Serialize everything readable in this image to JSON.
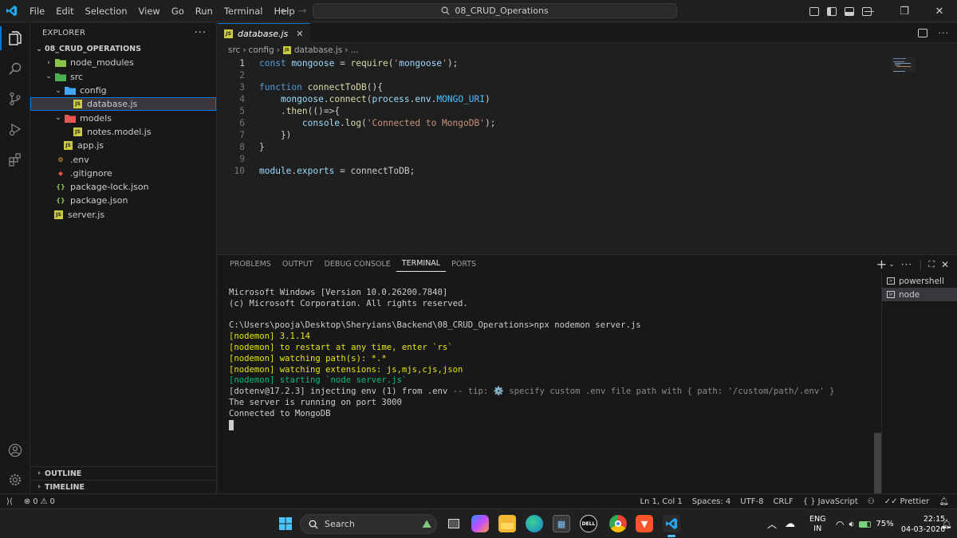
{
  "menu": [
    "File",
    "Edit",
    "Selection",
    "View",
    "Go",
    "Run",
    "Terminal",
    "Help"
  ],
  "command_center": "08_CRUD_Operations",
  "explorer": {
    "header": "EXPLORER",
    "project": "08_CRUD_OPERATIONS",
    "items": [
      {
        "label": "node_modules",
        "type": "folder",
        "depth": 1,
        "expanded": false
      },
      {
        "label": "src",
        "type": "folder",
        "depth": 1,
        "expanded": true
      },
      {
        "label": "config",
        "type": "folder",
        "depth": 2,
        "expanded": true
      },
      {
        "label": "database.js",
        "type": "js",
        "depth": 3,
        "selected": true
      },
      {
        "label": "models",
        "type": "folder",
        "depth": 2,
        "expanded": true
      },
      {
        "label": "notes.model.js",
        "type": "js",
        "depth": 3
      },
      {
        "label": "app.js",
        "type": "js",
        "depth": 2
      },
      {
        "label": ".env",
        "type": "env",
        "depth": 1
      },
      {
        "label": ".gitignore",
        "type": "git",
        "depth": 1
      },
      {
        "label": "package-lock.json",
        "type": "json",
        "depth": 1
      },
      {
        "label": "package.json",
        "type": "json",
        "depth": 1
      },
      {
        "label": "server.js",
        "type": "js",
        "depth": 1
      }
    ],
    "outline": "OUTLINE",
    "timeline": "TIMELINE"
  },
  "editor": {
    "tab": "database.js",
    "breadcrumbs": [
      "src",
      "config",
      "database.js",
      "..."
    ],
    "lines": [
      "const mongoose = require('mongoose');",
      "",
      "function connectToDB(){",
      "    mongoose.connect(process.env.MONGO_URI)",
      "    .then(()=>{",
      "        console.log('Connected to MongoDB');",
      "    })",
      "}",
      "",
      "module.exports = connectToDB;"
    ]
  },
  "panel": {
    "tabs": [
      "PROBLEMS",
      "OUTPUT",
      "DEBUG CONSOLE",
      "TERMINAL",
      "PORTS"
    ],
    "active_tab": "TERMINAL",
    "terminals": [
      "powershell",
      "node"
    ],
    "terminal_lines": [
      "Microsoft Windows [Version 10.0.26200.7840]",
      "(c) Microsoft Corporation. All rights reserved.",
      "",
      "C:\\Users\\pooja\\Desktop\\Sheryians\\Backend\\08_CRUD_Operations>npx nodemon server.js",
      "[nodemon] 3.1.14",
      "[nodemon] to restart at any time, enter `rs`",
      "[nodemon] watching path(s): *.*",
      "[nodemon] watching extensions: js,mjs,cjs,json",
      "[nodemon] starting `node server.js`",
      "[dotenv@17.2.3] injecting env (1) from .env -- tip: ⚙️ specify custom .env file path with { path: '/custom/path/.env' }",
      "The server is running on port 3000",
      "Connected to MongoDB"
    ]
  },
  "status": {
    "errors": "0",
    "warnings": "0",
    "position": "Ln 1, Col 1",
    "spaces": "Spaces: 4",
    "encoding": "UTF-8",
    "eol": "CRLF",
    "language": "JavaScript",
    "prettier": "Prettier"
  },
  "taskbar": {
    "search": "Search",
    "lang": "ENG",
    "region": "IN",
    "battery": "75%",
    "time": "22:15",
    "date": "04-03-2026"
  }
}
